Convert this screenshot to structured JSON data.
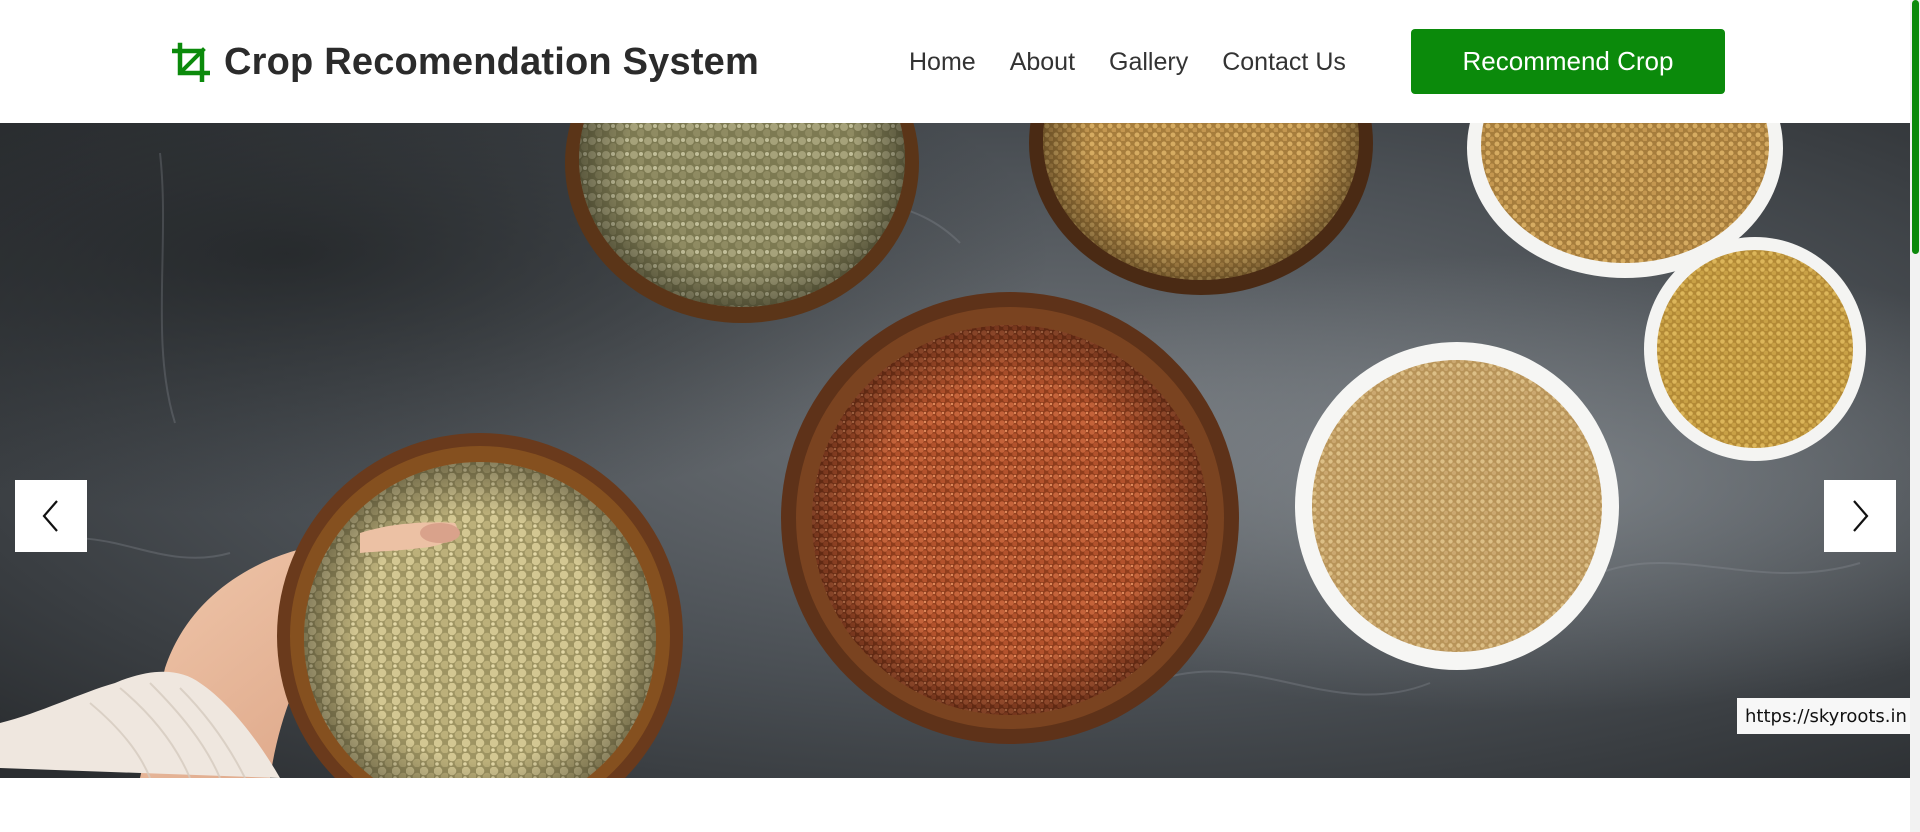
{
  "header": {
    "brand": {
      "icon": "crop-icon",
      "title": "Crop Recomendation System"
    },
    "nav": [
      {
        "label": "Home"
      },
      {
        "label": "About"
      },
      {
        "label": "Gallery"
      },
      {
        "label": "Contact Us"
      }
    ],
    "cta_label": "Recommend Crop"
  },
  "hero": {
    "prev_icon": "chevron-left-icon",
    "next_icon": "chevron-right-icon",
    "image_credit": "https://skyroots.in"
  },
  "colors": {
    "accent": "#0b8a0b",
    "text": "#2b2b2b",
    "hero_background": "#3e4246"
  }
}
